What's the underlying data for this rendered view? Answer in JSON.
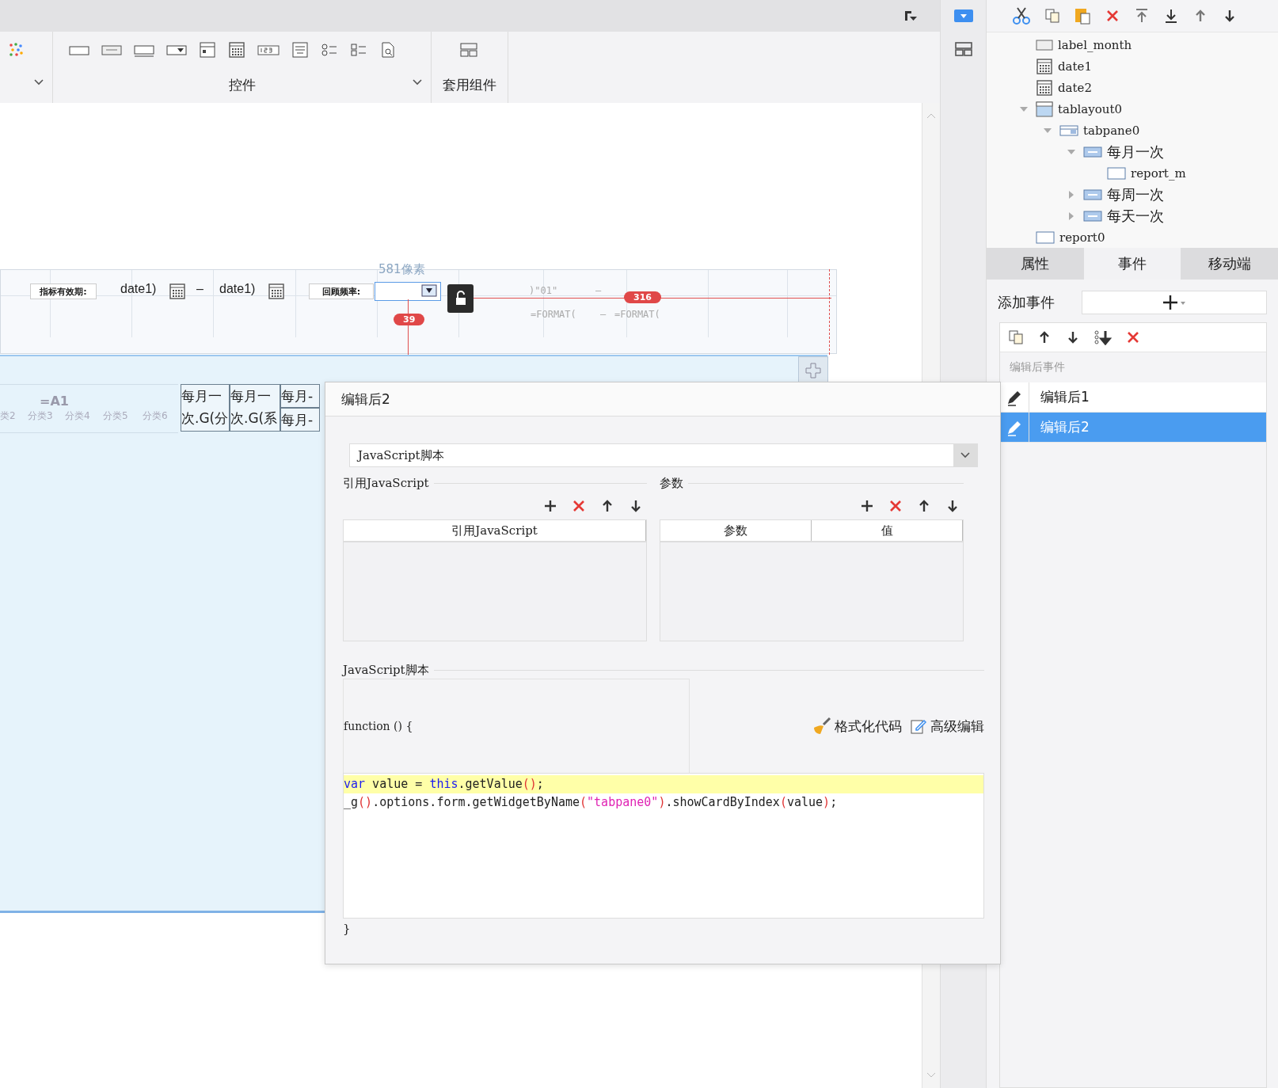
{
  "ribbon": {
    "group_labels": [
      "控件",
      "套用组件"
    ]
  },
  "canvas": {
    "form_labels": [
      "指标有效期:",
      "回顾频率:"
    ],
    "date_fields": [
      "date1)",
      "date1)"
    ],
    "date_dash": "–",
    "width_hint": "581像素",
    "height_badge": "39",
    "offset_badge": "316",
    "faded_texts": [
      ")\"01\"",
      "–",
      "=FORMAT(",
      "–",
      "=FORMAT("
    ],
    "header_cells": [
      "类2",
      "分类3",
      "分类4",
      "分类5",
      "分类6"
    ],
    "header_formula": "=A1",
    "month_cells": [
      "每月一次.G(分",
      "每月一次.G(系",
      "每月-",
      "每月-"
    ]
  },
  "tree": [
    {
      "label": "label_month",
      "kind": "label"
    },
    {
      "label": "date1",
      "kind": "date"
    },
    {
      "label": "date2",
      "kind": "date"
    },
    {
      "label": "tablayout0",
      "kind": "layout",
      "expanded": true,
      "children": [
        {
          "label": "tabpane0",
          "kind": "tabpane",
          "expanded": true,
          "children": [
            {
              "label": "每月一次",
              "kind": "tab",
              "expanded": true,
              "children": [
                {
                  "label": "report_m",
                  "kind": "report"
                }
              ]
            },
            {
              "label": "每周一次",
              "kind": "tab",
              "expanded": false
            },
            {
              "label": "每天一次",
              "kind": "tab",
              "expanded": false
            }
          ]
        }
      ]
    },
    {
      "label": "report0",
      "kind": "report"
    }
  ],
  "panel_tabs": [
    {
      "label": "属性",
      "selected": false
    },
    {
      "label": "事件",
      "selected": true
    },
    {
      "label": "移动端",
      "selected": false
    }
  ],
  "add_event": {
    "label": "添加事件"
  },
  "events": {
    "group": "编辑后事件",
    "items": [
      {
        "label": "编辑后1",
        "selected": false
      },
      {
        "label": "编辑后2",
        "selected": true
      }
    ]
  },
  "dialog": {
    "title": "编辑后2",
    "type": "JavaScript脚本",
    "ref_section": "引用JavaScript",
    "ref_columns": [
      "引用JavaScript"
    ],
    "param_section": "参数",
    "param_columns": [
      "参数",
      "值"
    ],
    "script_section": "JavaScript脚本",
    "header": "function () {",
    "actions": [
      "格式化代码",
      "高级编辑"
    ],
    "code": [
      {
        "highlighted": true,
        "tokens": [
          {
            "t": "var",
            "kind": "keyword"
          },
          {
            "t": " value = ",
            "kind": "plain"
          },
          {
            "t": "this",
            "kind": "keyword"
          },
          {
            "t": ".getValue",
            "kind": "plain"
          },
          {
            "t": "()",
            "kind": "paren"
          },
          {
            "t": ";",
            "kind": "plain"
          }
        ]
      },
      {
        "highlighted": false,
        "tokens": [
          {
            "t": "_g",
            "kind": "plain"
          },
          {
            "t": "()",
            "kind": "paren"
          },
          {
            "t": ".options.form.getWidgetByName",
            "kind": "plain"
          },
          {
            "t": "(",
            "kind": "paren"
          },
          {
            "t": "\"tabpane0\"",
            "kind": "string"
          },
          {
            "t": ")",
            "kind": "paren"
          },
          {
            "t": ".showCardByIndex",
            "kind": "plain"
          },
          {
            "t": "(",
            "kind": "paren"
          },
          {
            "t": "value",
            "kind": "plain"
          },
          {
            "t": ")",
            "kind": "paren"
          },
          {
            "t": ";",
            "kind": "plain"
          }
        ]
      }
    ],
    "footer": "}"
  }
}
